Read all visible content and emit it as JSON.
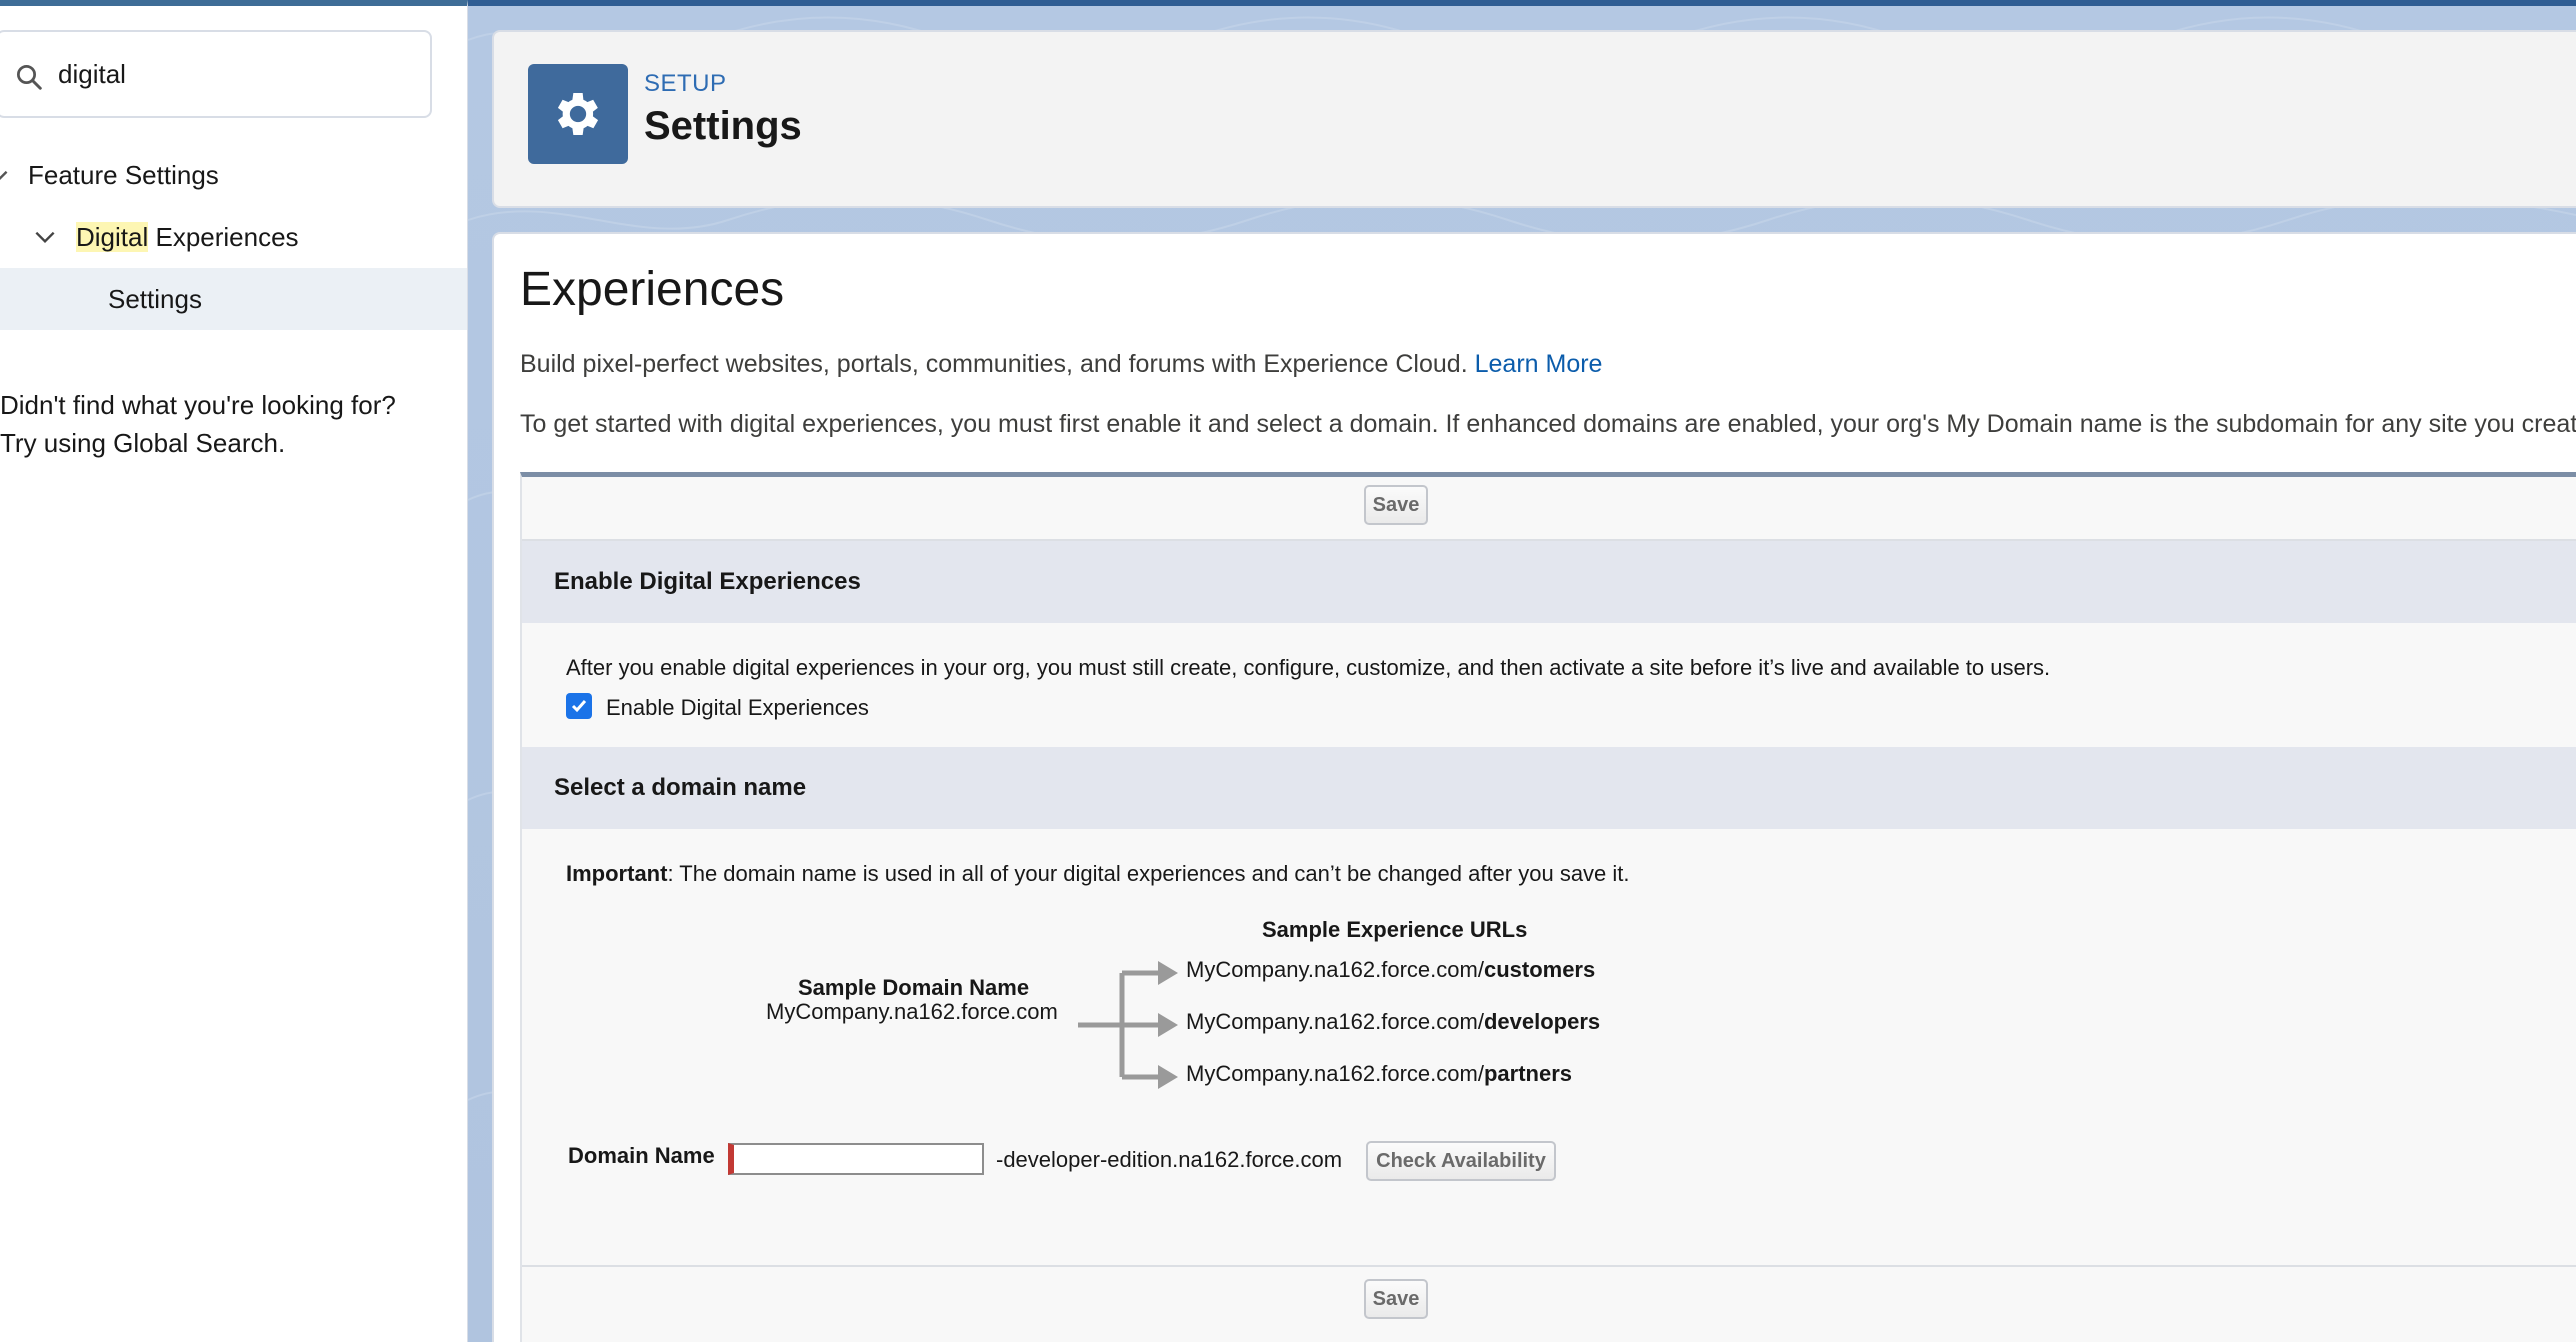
{
  "sidebar": {
    "search": {
      "value": "digital",
      "placeholder": ""
    },
    "tree": {
      "feature_settings": "Feature Settings",
      "digital_experiences_highlight": "Digital",
      "digital_experiences_rest": " Experiences",
      "settings": "Settings"
    },
    "help": {
      "line1": "Didn't find what you're looking for?",
      "line2": "Try using Global Search."
    }
  },
  "header": {
    "eyebrow": "SETUP",
    "title": "Settings",
    "icon": "gear-icon"
  },
  "page": {
    "title": "Experiences",
    "intro1": "Build pixel-perfect websites, portals, communities, and forums with Experience Cloud.",
    "learn_more": "Learn More",
    "intro2": "To get started with digital experiences, you must first enable it and select a domain. If enhanced domains are enabled, your org's My Domain name is the subdomain for any site you create."
  },
  "form": {
    "save_label": "Save",
    "enable_section": {
      "title": "Enable Digital Experiences",
      "description": "After you enable digital experiences in your org, you must still create, configure, customize, and then activate a site before it’s live and available to users.",
      "checkbox_label": "Enable Digital Experiences",
      "checked": true
    },
    "domain_section": {
      "title": "Select a domain name",
      "important_label": "Important",
      "important_text": ": The domain name is used in all of your digital experiences and can’t be changed after you save it.",
      "sample_urls_title": "Sample Experience URLs",
      "sample_domain_title": "Sample Domain Name",
      "sample_domain_value": "MyCompany.na162.force.com",
      "sample_urls": [
        {
          "prefix": "MyCompany.na162.force.com/",
          "suffix": "customers"
        },
        {
          "prefix": "MyCompany.na162.force.com/",
          "suffix": "developers"
        },
        {
          "prefix": "MyCompany.na162.force.com/",
          "suffix": "partners"
        }
      ],
      "domain_label": "Domain Name",
      "domain_value": "",
      "domain_suffix": "-developer-edition.na162.force.com",
      "check_availability_label": "Check Availability"
    }
  },
  "colors": {
    "brand_blue": "#2e6cb3",
    "link": "#0b5cab",
    "required": "#c23934",
    "checkbox": "#1b73e8"
  }
}
